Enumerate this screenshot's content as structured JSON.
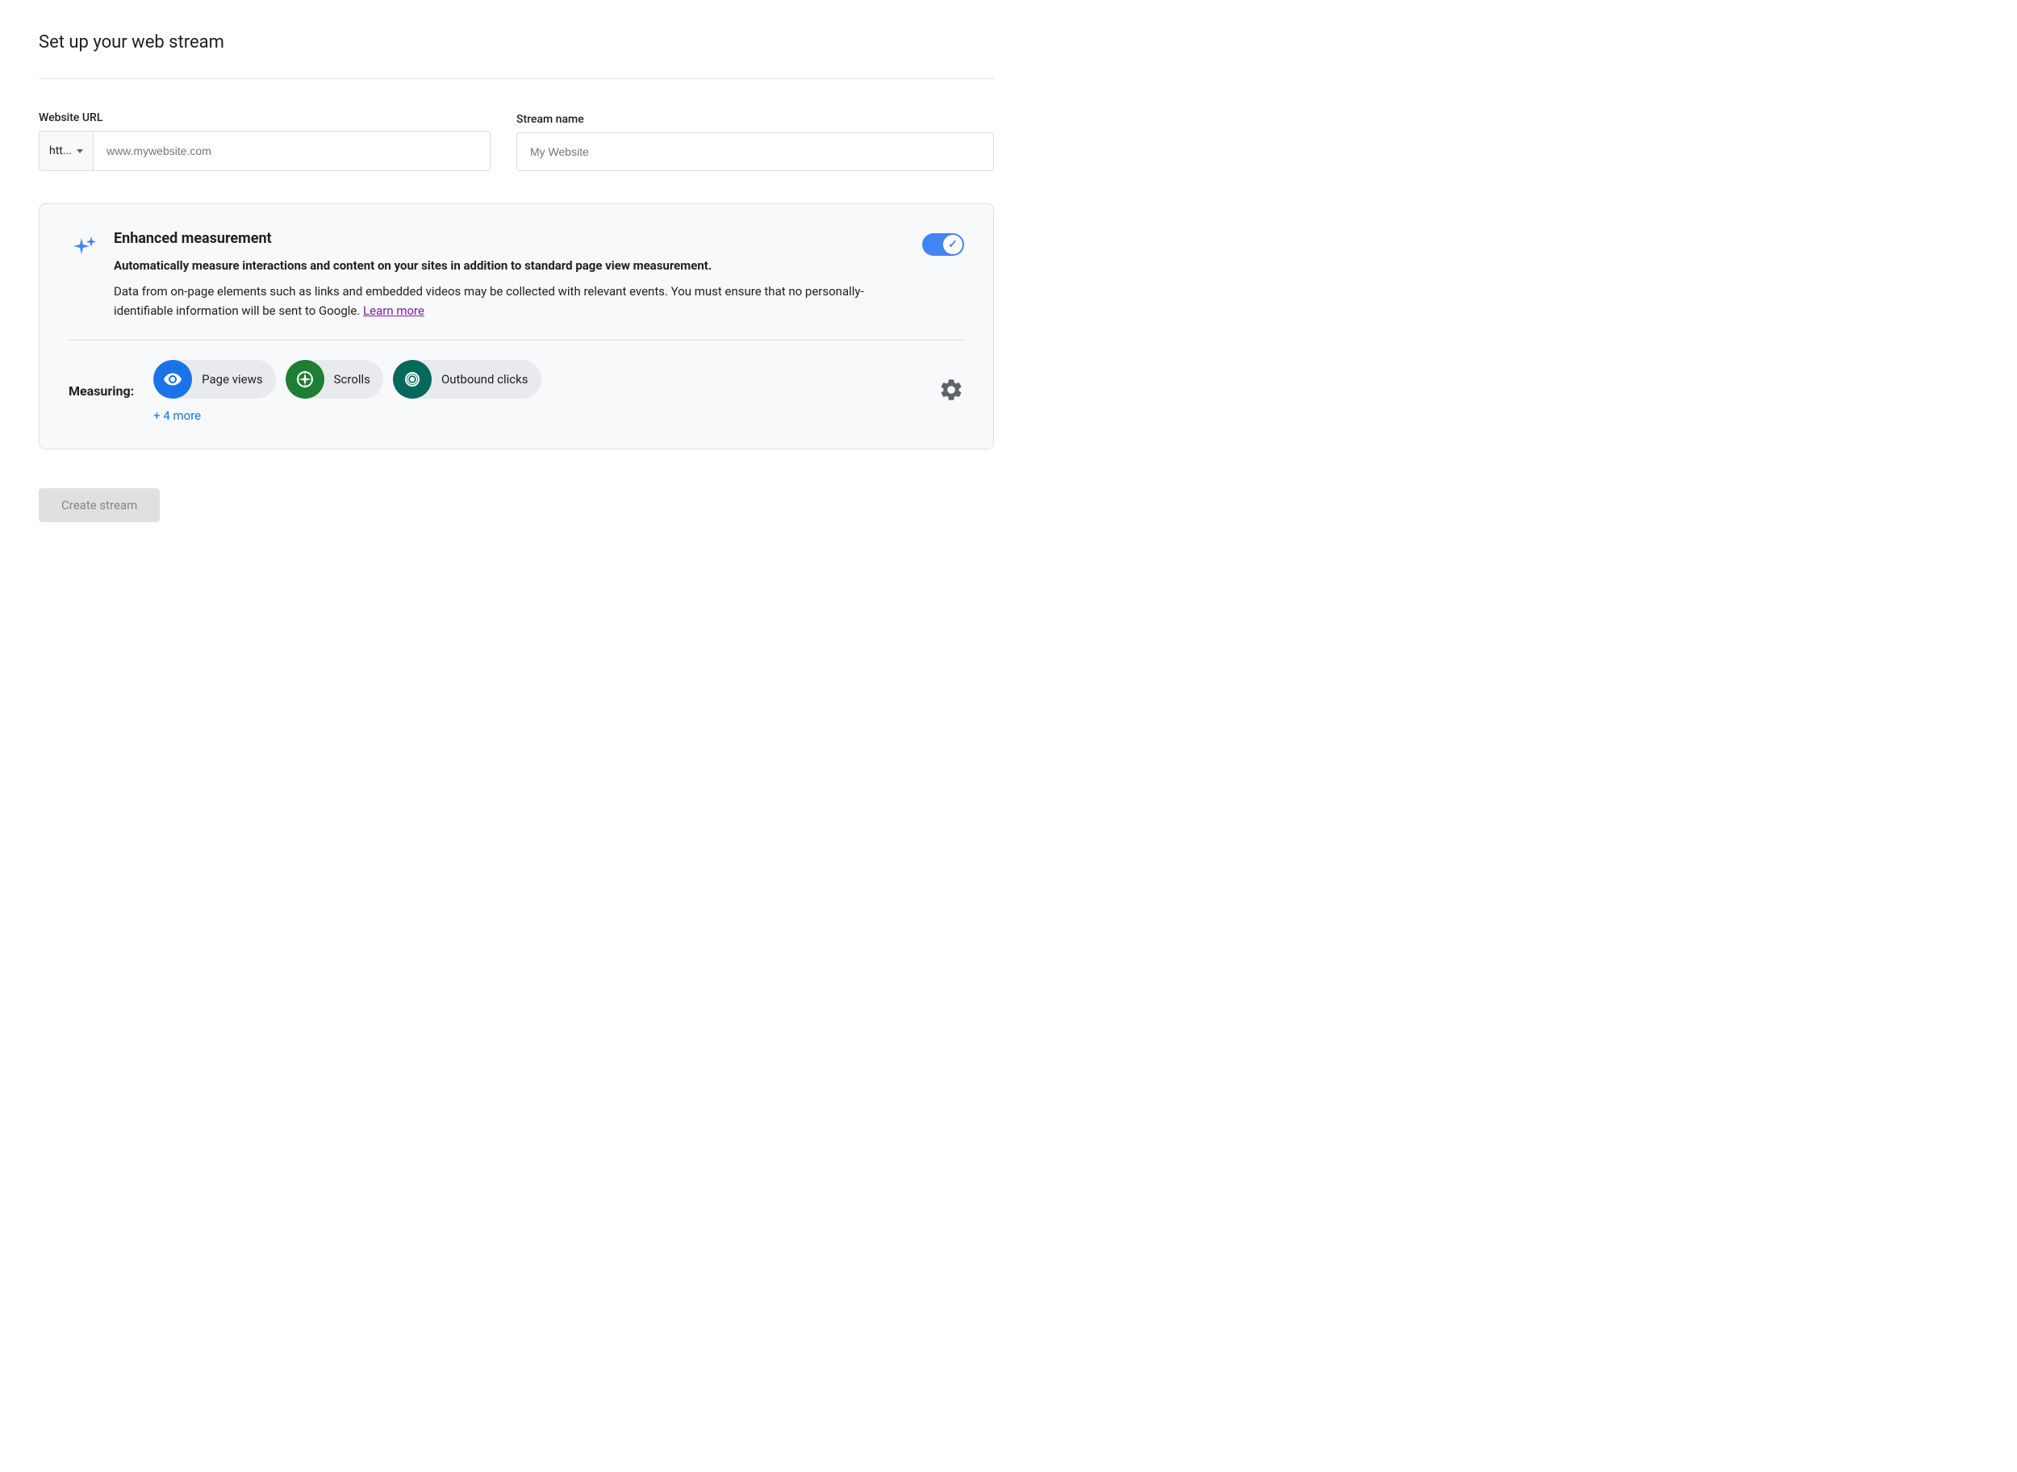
{
  "page": {
    "title": "Set up your web stream"
  },
  "url_section": {
    "website_url_label": "Website URL",
    "protocol_value": "htt...",
    "url_placeholder": "www.mywebsite.com",
    "stream_name_label": "Stream name",
    "stream_name_placeholder": "My Website"
  },
  "enhanced": {
    "title": "Enhanced measurement",
    "description_bold": "Automatically measure interactions and content on your sites in addition to standard page view measurement.",
    "description": "Data from on-page elements such as links and embedded videos may be collected with relevant events. You must ensure that no personally-identifiable information will be sent to Google.",
    "learn_more_label": "Learn more",
    "toggle_enabled": true
  },
  "measuring": {
    "label": "Measuring:",
    "chips": [
      {
        "id": "page-views",
        "label": "Page views",
        "icon_type": "eye",
        "icon_color": "blue"
      },
      {
        "id": "scrolls",
        "label": "Scrolls",
        "icon_type": "compass",
        "icon_color": "green"
      },
      {
        "id": "outbound-clicks",
        "label": "Outbound clicks",
        "icon_type": "mouse",
        "icon_color": "teal"
      }
    ],
    "more_label": "+ 4 more"
  },
  "footer": {
    "create_btn_label": "Create stream"
  }
}
